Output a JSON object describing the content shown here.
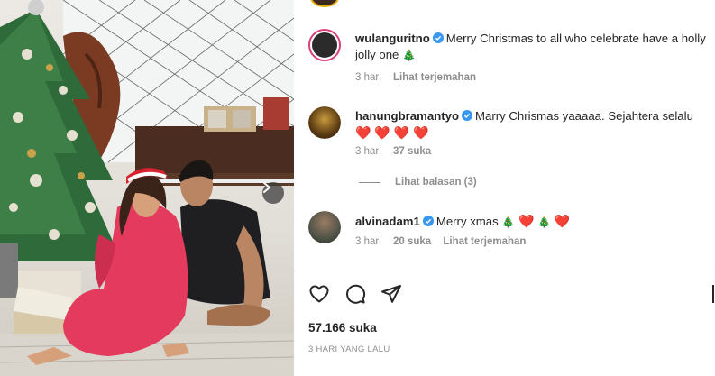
{
  "post": {
    "likes": "57.166 suka",
    "date": "3 HARI YANG LALU"
  },
  "comments": [
    {
      "username": "wulanguritno",
      "text": "Merry Christmas to all who celebrate have a holly jolly one",
      "time": "3 hari",
      "likes": "",
      "translate": "Lihat terjemahan",
      "avatar_color": "#2b2b2b"
    },
    {
      "username": "hanungbramantyo",
      "text": "Marry Chrismas yaaaaa. Sejahtera selalu",
      "time": "3 hari",
      "likes": "37 suka",
      "translate": "",
      "avatar_color": "#5a3a12"
    },
    {
      "username": "alvinadam1",
      "text": "Merry xmas",
      "time": "3 hari",
      "likes": "20 suka",
      "translate": "Lihat terjemahan",
      "avatar_color": "#4a4f45"
    }
  ],
  "replies_label": "Lihat balasan (3)",
  "icons": {
    "like": "heart-icon",
    "comment": "comment-icon",
    "share": "send-icon",
    "save": "bookmark-icon",
    "next": "chevron-right-icon",
    "verified": "verified-badge-icon"
  },
  "colors": {
    "verified": "#3897f0",
    "heart_emoji": "#e0182d",
    "tree_emoji": "#2e8b2e",
    "muted": "#8e8e8e",
    "text": "#262626"
  }
}
